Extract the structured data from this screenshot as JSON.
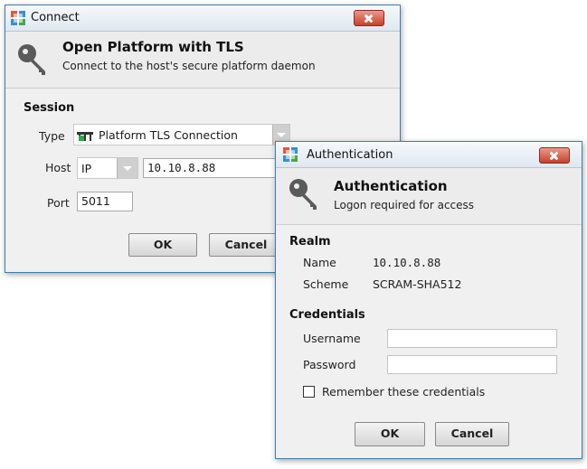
{
  "connect": {
    "title": "Connect",
    "header_title": "Open Platform with TLS",
    "header_subtitle": "Connect to the host's secure platform daemon",
    "session_label": "Session",
    "type_label": "Type",
    "type_value": "Platform TLS Connection",
    "host_label": "Host",
    "host_type": "IP",
    "host_value": "10.10.8.88",
    "port_label": "Port",
    "port_value": "5011",
    "ok_label": "OK",
    "cancel_label": "Cancel"
  },
  "auth": {
    "title": "Authentication",
    "header_title": "Authentication",
    "header_subtitle": "Logon required for access",
    "realm_label": "Realm",
    "name_label": "Name",
    "name_value": "10.10.8.88",
    "scheme_label": "Scheme",
    "scheme_value": "SCRAM-SHA512",
    "credentials_label": "Credentials",
    "username_label": "Username",
    "username_value": "",
    "password_label": "Password",
    "password_value": "",
    "remember_label": "Remember these credentials",
    "remember_checked": false,
    "ok_label": "OK",
    "cancel_label": "Cancel"
  },
  "colors": {
    "close_button": "#c8412a",
    "title_border": "#3c7fb1"
  },
  "icons": [
    "app-icon",
    "key-icon",
    "close-icon",
    "connection-icon",
    "chevron-down-icon",
    "checkbox-icon"
  ]
}
